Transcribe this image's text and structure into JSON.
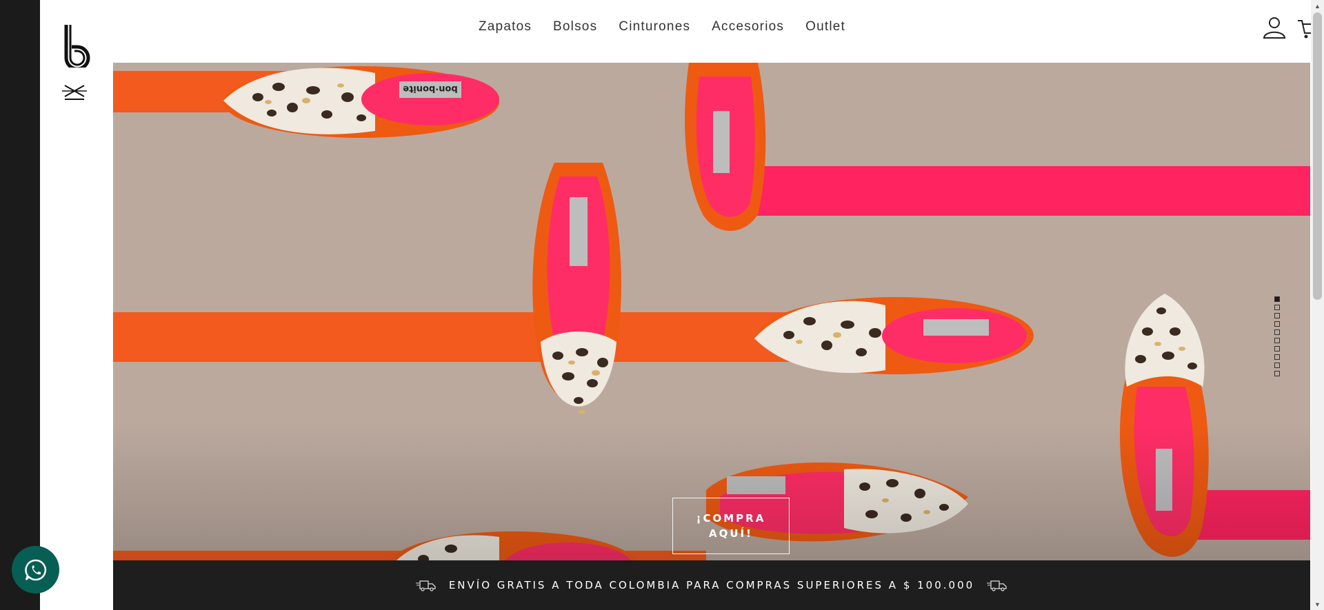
{
  "nav": {
    "items": [
      {
        "label": "Zapatos"
      },
      {
        "label": "Bolsos"
      },
      {
        "label": "Cinturones"
      },
      {
        "label": "Accesorios"
      },
      {
        "label": "Outlet"
      }
    ]
  },
  "hero": {
    "cta_line1": "¡COMPRA",
    "cta_line2": "AQUÍ!",
    "brand_label": "bon·bonite",
    "slides_total": 10,
    "active_slide": 1
  },
  "banner": {
    "text": "ENVÍO GRATIS A TODA COLOMBIA PARA COMPRAS SUPERIORES A $ 100.000"
  },
  "icons": {
    "logo": "logo-b-icon",
    "menu": "menu-toggle-icon",
    "user": "user-icon",
    "cart": "cart-icon",
    "truck": "truck-icon",
    "whatsapp": "whatsapp-icon"
  },
  "colors": {
    "hero_background": "#bba99e",
    "orange": "#f25a1e",
    "pink": "#ff2360",
    "dark": "#1e1e1e",
    "whatsapp": "#075e54"
  }
}
